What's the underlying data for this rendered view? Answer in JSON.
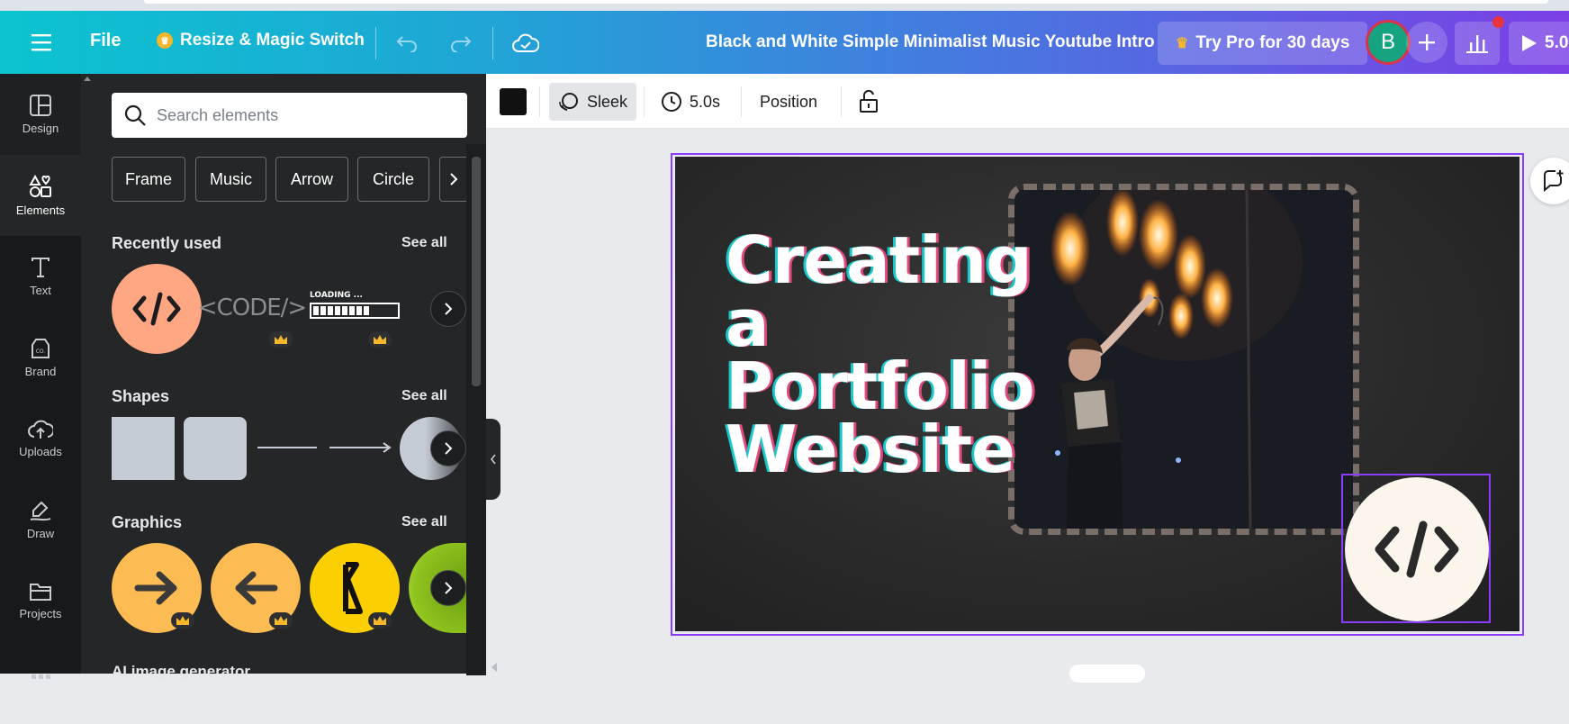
{
  "topbar": {
    "file_label": "File",
    "resize_label": "Resize & Magic Switch",
    "doc_title": "Black and White Simple Minimalist Music Youtube Intro",
    "try_pro_label": "Try Pro for 30 days",
    "avatar_initial": "B",
    "present_label": "5.0"
  },
  "rail": {
    "items": [
      {
        "label": "Design"
      },
      {
        "label": "Elements"
      },
      {
        "label": "Text"
      },
      {
        "label": "Brand"
      },
      {
        "label": "Uploads"
      },
      {
        "label": "Draw"
      },
      {
        "label": "Projects"
      }
    ]
  },
  "panel": {
    "search_placeholder": "Search elements",
    "chips": [
      "Frame",
      "Music",
      "Arrow",
      "Circle"
    ],
    "recently_used_title": "Recently used",
    "shapes_title": "Shapes",
    "graphics_title": "Graphics",
    "see_all": "See all",
    "next_section_title": "AI image generator",
    "code_text_thumb": "<CODE/>",
    "loading_text_thumb": "LOADING ..."
  },
  "context_bar": {
    "animation_label": "Sleek",
    "duration_label": "5.0s",
    "position_label": "Position"
  },
  "design": {
    "headline_lines": [
      "Creating",
      "a",
      "Portfolio",
      "Website"
    ]
  },
  "colors": {
    "brand_gradient_start": "#0bc4cf",
    "brand_gradient_end": "#7b3fe6",
    "selection": "#8b3dff",
    "panel_bg": "#252627",
    "rail_bg": "#18191b",
    "graphic_orange": "#fdbb54",
    "graphic_yellow": "#fccf03",
    "recent_orange": "#ffa682"
  }
}
